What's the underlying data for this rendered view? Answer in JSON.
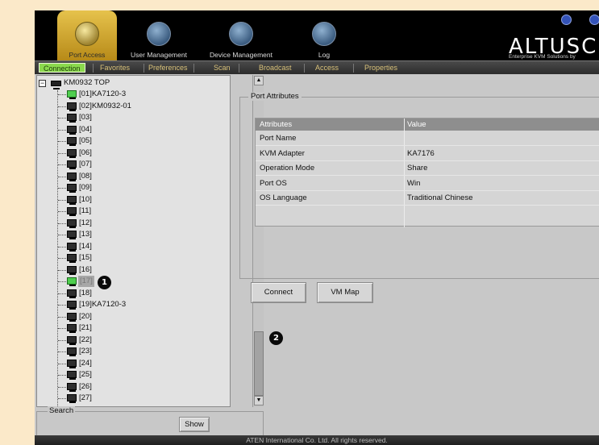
{
  "header": {
    "tabs": [
      {
        "label": "Port Access",
        "active": true
      },
      {
        "label": "User Management",
        "active": false
      },
      {
        "label": "Device Management",
        "active": false
      },
      {
        "label": "Log",
        "active": false
      }
    ],
    "logo_text": "ALTUSC",
    "tagline": "Enterprise KVM Solutions by"
  },
  "subtabs": [
    "Connection",
    "Favorites",
    "Preferences",
    "Scan",
    "Broadcast",
    "Access",
    "Properties"
  ],
  "tree": {
    "root": "KM0932 TOP",
    "ports": [
      "[01]KA7120-3",
      "[02]KM0932-01",
      "[03]",
      "[04]",
      "[05]",
      "[06]",
      "[07]",
      "[08]",
      "[09]",
      "[10]",
      "[11]",
      "[12]",
      "[13]",
      "[14]",
      "[15]",
      "[16]",
      "[17]",
      "[18]",
      "[19]KA7120-3",
      "[20]",
      "[21]",
      "[22]",
      "[23]",
      "[24]",
      "[25]",
      "[26]",
      "[27]"
    ],
    "selected": "[17]"
  },
  "search": {
    "label": "Search",
    "show_button": "Show"
  },
  "attributes": {
    "legend": "Port Attributes",
    "headers": [
      "Attributes",
      "Value"
    ],
    "rows": [
      {
        "name": "Port Name",
        "value": ""
      },
      {
        "name": "KVM Adapter",
        "value": "KA7176"
      },
      {
        "name": "Operation Mode",
        "value": "Share"
      },
      {
        "name": "Port OS",
        "value": "Win"
      },
      {
        "name": "OS Language",
        "value": "Traditional Chinese"
      }
    ]
  },
  "actions": {
    "connect": "Connect",
    "vm_map": "VM Map"
  },
  "callouts": [
    "1",
    "2"
  ],
  "footer": "ATEN International Co. Ltd. All rights reserved.",
  "colors": {
    "active_subtab": "#8bd94d",
    "active_tab": "#d4a92a",
    "header_bg": "#000000",
    "background": "#fbe9c9"
  }
}
